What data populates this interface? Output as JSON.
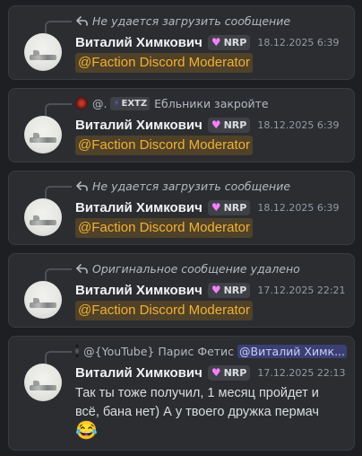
{
  "messages": [
    {
      "reply_text": "Не удается загрузить сообщение",
      "author": "Виталий Химкович",
      "tag": "NRP",
      "time": "18.12.2025 6:39",
      "mention": "@Faction Discord Moderator"
    },
    {
      "reply_author": "@.",
      "reply_tag": "EXTZ",
      "reply_text": "Ебльники закройте",
      "author": "Виталий Химкович",
      "tag": "NRP",
      "time": "18.12.2025 6:39",
      "mention": "@Faction Discord Moderator"
    },
    {
      "reply_text": "Не удается загрузить сообщение",
      "author": "Виталий Химкович",
      "tag": "NRP",
      "time": "18.12.2025 6:39",
      "mention": "@Faction Discord Moderator"
    },
    {
      "reply_text": "Оригинальное сообщение удалено",
      "author": "Виталий Химкович",
      "tag": "NRP",
      "time": "17.12.2025 22:21",
      "mention": "@Faction Discord Moderator"
    },
    {
      "reply_author": "@{YouTube} Парис Фетис",
      "reply_mention": "@Виталий Химк...",
      "author": "Виталий Химкович",
      "tag": "NRP",
      "time": "17.12.2025 22:13",
      "text": "Так ты тоже получил, 1 месяц пройдет и всё, бана нет) А у твоего дружка пермач",
      "emoji": "😂"
    }
  ],
  "colors": {
    "background": "#1e1f22",
    "card": "#2b2d31",
    "mention_text": "#f0b232",
    "tag_heart": "#f47fff"
  },
  "icons": {
    "reply": "reply-arrow-icon",
    "tag": "heart-icon",
    "ref_tag": "lightning-icon"
  }
}
